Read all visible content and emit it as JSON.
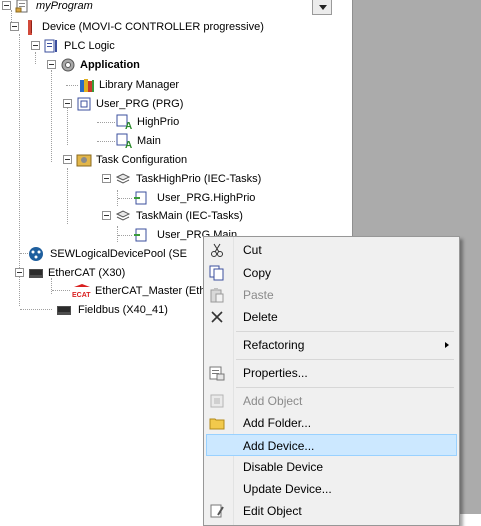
{
  "tree": {
    "root": "myProgram",
    "device": "Device (MOVI-C CONTROLLER progressive)",
    "plc_logic": "PLC Logic",
    "application": "Application",
    "library_manager": "Library Manager",
    "user_prg": "User_PRG (PRG)",
    "highprio": "HighPrio",
    "main": "Main",
    "task_configuration": "Task Configuration",
    "task_highprio": "TaskHighPrio (IEC-Tasks)",
    "user_prg_highprio": "User_PRG.HighPrio",
    "task_main": "TaskMain (IEC-Tasks)",
    "user_prg_main": "User_PRG.Main",
    "sew_pool": "SEWLogicalDevicePool (SE",
    "ethercat": "EtherCAT (X30)",
    "ethercat_master": "EtherCAT_Master (Eth",
    "fieldbus": "Fieldbus (X40_41)",
    "ecat_badge": "ECAT"
  },
  "context_menu": {
    "cut": "Cut",
    "copy": "Copy",
    "paste": "Paste",
    "delete": "Delete",
    "refactoring": "Refactoring",
    "properties": "Properties...",
    "add_object": "Add Object",
    "add_folder": "Add Folder...",
    "add_device": "Add Device...",
    "disable_device": "Disable Device",
    "update_device": "Update Device...",
    "edit_object": "Edit Object"
  },
  "colors": {
    "highlight": "#cce8ff",
    "menu_bg": "#f0f0f0",
    "side_panel": "#ababab"
  },
  "icons": {
    "cut": "scissors-icon",
    "copy": "copy-icon",
    "paste": "paste-icon",
    "delete": "delete-x-icon",
    "properties": "properties-icon",
    "add_object": "add-object-icon",
    "add_folder": "folder-icon",
    "edit_object": "edit-object-icon"
  }
}
